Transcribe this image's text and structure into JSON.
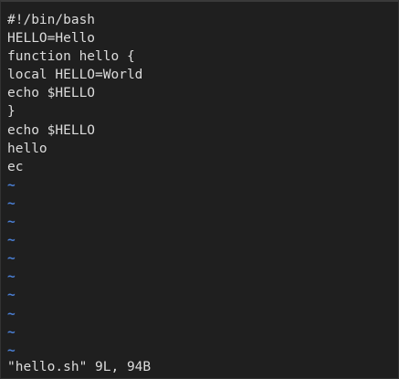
{
  "editor": {
    "lines": [
      "#!/bin/bash",
      "HELLO=Hello",
      "function hello {",
      "local HELLO=World",
      "echo $HELLO",
      "}",
      "echo $HELLO",
      "hello",
      "ec"
    ],
    "empty_line_marker": "~",
    "empty_line_count": 10,
    "marker_color": "#4a7fd4"
  },
  "status": {
    "message": "\"hello.sh\" 9L, 94B"
  }
}
